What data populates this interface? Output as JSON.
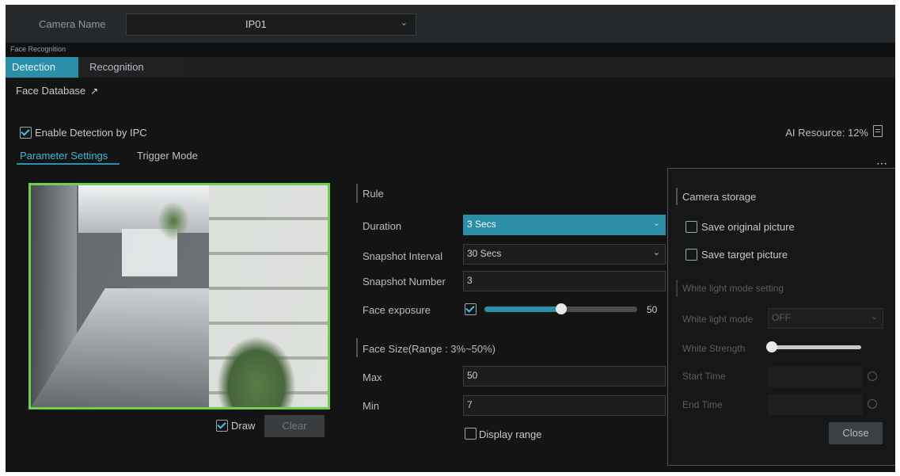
{
  "header": {
    "camera_label": "Camera Name",
    "camera_value": "IP01"
  },
  "section_title": "Face Recognition",
  "tabs": [
    {
      "label": "Detection",
      "active": true
    },
    {
      "label": "Recognition",
      "active": false
    }
  ],
  "face_database": "Face Database",
  "enable_detection": {
    "label": "Enable Detection by IPC",
    "checked": true
  },
  "ai_resource": "AI Resource: 12%",
  "subtabs": [
    {
      "label": "Parameter Settings",
      "active": true
    },
    {
      "label": "Trigger Mode",
      "active": false
    }
  ],
  "preview": {
    "draw_label": "Draw",
    "draw_checked": true,
    "clear_label": "Clear"
  },
  "rule": {
    "title": "Rule",
    "duration_label": "Duration",
    "duration_value": "3 Secs",
    "interval_label": "Snapshot Interval",
    "interval_value": "30 Secs",
    "number_label": "Snapshot Number",
    "number_value": "3",
    "exposure_label": "Face exposure",
    "exposure_checked": true,
    "exposure_value": "50",
    "exposure_level": 50
  },
  "face_size": {
    "title": "Face Size(Range : 3%~50%)",
    "max_label": "Max",
    "max_value": "50",
    "min_label": "Min",
    "min_value": "7",
    "display_range_label": "Display range",
    "display_range_checked": false
  },
  "popup": {
    "camera_storage": "Camera storage",
    "save_original": "Save original picture",
    "save_target": "Save target picture",
    "white_light_title": "White light mode setting",
    "white_light_mode_label": "White light mode",
    "white_light_mode_value": "OFF",
    "white_strength_label": "White Strength",
    "white_strength_level": 0,
    "start_time_label": "Start Time",
    "end_time_label": "End Time",
    "close_label": "Close"
  },
  "colors": {
    "accent": "#2a8fa8",
    "draw_region": "#6fd24a",
    "background": "#141414"
  }
}
